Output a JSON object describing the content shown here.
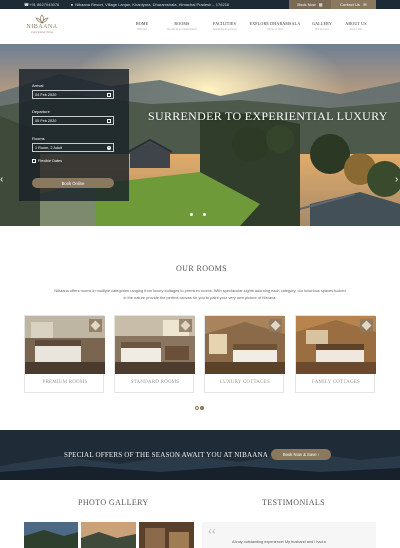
{
  "topbar": {
    "phone": "+91 8627043076",
    "address": "Nibaana Resort, Village Lanjan, Khaniyara, Dharamshala, Himachal Pradesh – 176216",
    "book_now": "Book Now",
    "contact_us": "Contact Us"
  },
  "logo": {
    "brand": "NIBAANA",
    "tagline": "experiential living"
  },
  "nav": [
    {
      "label": "HOME",
      "sub": "Welcome"
    },
    {
      "label": "ROOMS",
      "sub": "Rooms & accommodation"
    },
    {
      "label": "FACILITIES",
      "sub": "Amenities & services"
    },
    {
      "label": "EXPLORE DHARAMSALA",
      "sub": "Places to visit"
    },
    {
      "label": "GALLERY",
      "sub": "Our pictures"
    },
    {
      "label": "ABOUT US",
      "sub": "Resort info"
    }
  ],
  "hero": {
    "title": "SURRENDER TO EXPERIENTIAL LUXURY",
    "prev": "‹",
    "next": "›"
  },
  "booking": {
    "arrival_label": "Arrival",
    "arrival_value": "04 Feb 2020",
    "departure_label": "Departure",
    "departure_value": "05 Feb 2020",
    "rooms_label": "Rooms",
    "rooms_value": "1 Room, 2 Adult",
    "flexible_label": "Flexible Dates",
    "submit_label": "Book Online"
  },
  "our_rooms": {
    "title": "OUR ROOMS",
    "description": "Nibaana offers rooms in multiple categories ranging from luxury cottages to premium rooms. With spectacular sights adorning each category, our luxurious spaces tucked in the nature provide the perfect canvas for you to paint your very own picture of Nirvana.",
    "cards": [
      {
        "caption": "PREMIUM ROOMS"
      },
      {
        "caption": "STANDARD ROOMS"
      },
      {
        "caption": "LUXURY COTTAGES"
      },
      {
        "caption": "FAMILY COTTAGES"
      }
    ]
  },
  "offers": {
    "text": "SPECIAL OFFERS OF THE SEASON AWAIT YOU AT NIBAANA",
    "button": "Book Now & Save"
  },
  "gallery": {
    "title": "PHOTO GALLERY"
  },
  "testimonials": {
    "title": "TESTIMONIALS",
    "quote_mark": "“",
    "text": "A truly outstanding experience! My husband and I had a"
  },
  "colors": {
    "topbar": "#1d2b36",
    "accent": "#8a785f",
    "offers_band": "#1f2c38"
  }
}
